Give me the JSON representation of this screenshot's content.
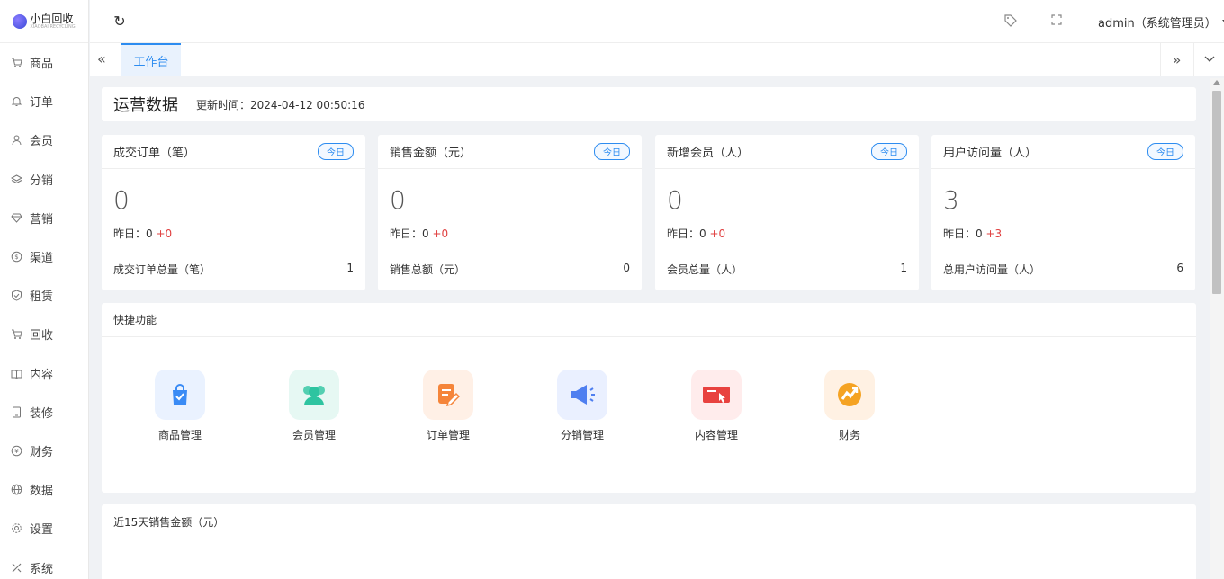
{
  "logo": {
    "name": "小白回收",
    "tagline": "XIAOBAI RECYCLING"
  },
  "sidebar": {
    "items": [
      {
        "label": "商品",
        "icon": "cart-icon"
      },
      {
        "label": "订单",
        "icon": "bell-icon"
      },
      {
        "label": "会员",
        "icon": "user-icon"
      },
      {
        "label": "分销",
        "icon": "layers-icon"
      },
      {
        "label": "营销",
        "icon": "diamond-icon"
      },
      {
        "label": "渠道",
        "icon": "dollar-icon"
      },
      {
        "label": "租赁",
        "icon": "shield-icon"
      },
      {
        "label": "回收",
        "icon": "cart-icon"
      },
      {
        "label": "内容",
        "icon": "book-icon"
      },
      {
        "label": "装修",
        "icon": "tablet-icon"
      },
      {
        "label": "财务",
        "icon": "yen-icon"
      },
      {
        "label": "数据",
        "icon": "globe-icon"
      },
      {
        "label": "设置",
        "icon": "gear-icon"
      },
      {
        "label": "系统",
        "icon": "tools-icon"
      }
    ]
  },
  "header": {
    "user": "admin（系统管理员）"
  },
  "tabs": {
    "active": "工作台"
  },
  "ops": {
    "title": "运营数据",
    "updated": "更新时间：2024-04-12 00:50:16"
  },
  "cards": [
    {
      "title": "成交订单（笔）",
      "badge": "今日",
      "value": "0",
      "yesterday_label": "昨日：0",
      "delta": "+0",
      "total_label": "成交订单总量（笔）",
      "total": "1"
    },
    {
      "title": "销售金额（元）",
      "badge": "今日",
      "value": "0",
      "yesterday_label": "昨日：0",
      "delta": "+0",
      "total_label": "销售总额（元）",
      "total": "0"
    },
    {
      "title": "新增会员（人）",
      "badge": "今日",
      "value": "0",
      "yesterday_label": "昨日：0",
      "delta": "+0",
      "total_label": "会员总量（人）",
      "total": "1"
    },
    {
      "title": "用户访问量（人）",
      "badge": "今日",
      "value": "3",
      "yesterday_label": "昨日：0",
      "delta": "+3",
      "total_label": "总用户访问量（人）",
      "total": "6"
    }
  ],
  "quick": {
    "title": "快捷功能",
    "items": [
      {
        "label": "商品管理",
        "icon": "shopping-bag-icon",
        "bg": "#eaf2ff",
        "color": "#3a8bf5"
      },
      {
        "label": "会员管理",
        "icon": "members-icon",
        "bg": "#e6f8f3",
        "color": "#2ec4a0"
      },
      {
        "label": "订单管理",
        "icon": "order-edit-icon",
        "bg": "#fff0e6",
        "color": "#f5853a"
      },
      {
        "label": "分销管理",
        "icon": "megaphone-icon",
        "bg": "#eaf0ff",
        "color": "#4f7ff0"
      },
      {
        "label": "内容管理",
        "icon": "content-card-icon",
        "bg": "#ffecec",
        "color": "#e8423f"
      },
      {
        "label": "财务",
        "icon": "finance-chart-icon",
        "bg": "#fff1e3",
        "color": "#f5a323"
      }
    ]
  },
  "sales": {
    "title": "近15天销售金额（元）"
  }
}
